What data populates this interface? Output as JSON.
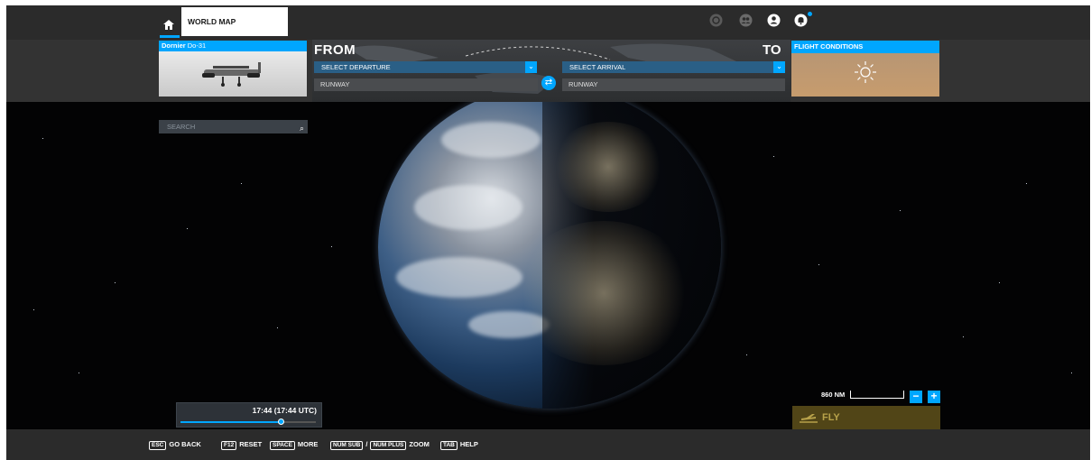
{
  "header": {
    "home_icon": "home-icon",
    "tab_title": "WORLD MAP",
    "icons": [
      "activity-icon",
      "multiplayer-icon",
      "profile-icon",
      "notifications-icon"
    ],
    "notification_count": "1"
  },
  "aircraft": {
    "maker": "Dornier",
    "model": "Do-31"
  },
  "plan": {
    "from_label": "FROM",
    "to_label": "TO",
    "departure_placeholder": "SELECT DEPARTURE",
    "arrival_placeholder": "SELECT ARRIVAL",
    "departure_runway": "RUNWAY",
    "arrival_runway": "RUNWAY"
  },
  "conditions": {
    "title": "FLIGHT CONDITIONS",
    "weather_icon": "sun-icon"
  },
  "search": {
    "placeholder": "SEARCH"
  },
  "time": {
    "label": "17:44 (17:44 UTC)",
    "slider_fraction": 0.74
  },
  "map": {
    "scale_label": "860 NM",
    "zoom_out": "−",
    "zoom_in": "+"
  },
  "fly": {
    "label": "FLY"
  },
  "footer": {
    "hints": [
      {
        "key": "ESC",
        "label": "GO BACK"
      },
      {
        "key": "F12",
        "label": "RESET"
      },
      {
        "key": "SPACE",
        "label": "MORE"
      },
      {
        "key": "NUM SUB",
        "sep": "/",
        "key2": "NUM PLUS",
        "label": "ZOOM"
      },
      {
        "key": "TAB",
        "label": "HELP"
      }
    ]
  },
  "colors": {
    "accent": "#00a6ff",
    "fly_button": "#514517",
    "bar": "#2b2b2b"
  }
}
